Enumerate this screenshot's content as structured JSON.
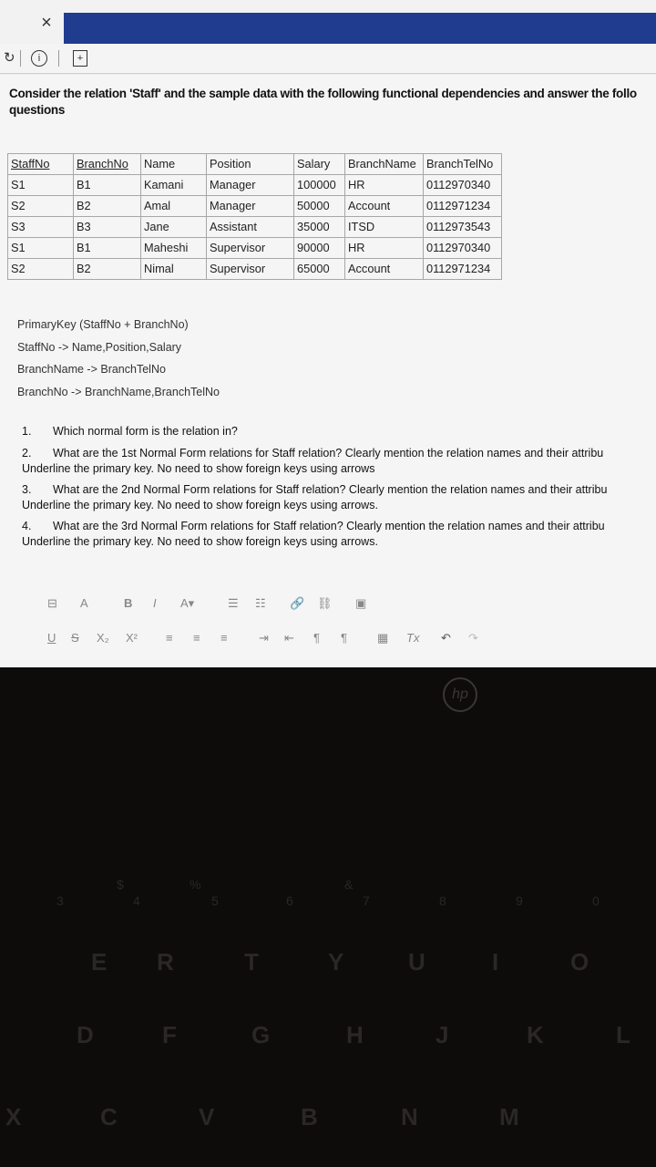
{
  "window": {
    "close_glyph": "×"
  },
  "toolbar_icons": [
    "refresh-icon",
    "info-icon",
    "new-tab-icon"
  ],
  "question": {
    "line1": "Consider the relation 'Staff' and the sample data with the following functional dependencies and answer the follo",
    "line2": "questions"
  },
  "table": {
    "headers": [
      "StaffNo",
      "BranchNo",
      "Name",
      "Position",
      "Salary",
      "BranchName",
      "BranchTelNo"
    ],
    "rows": [
      [
        "S1",
        "B1",
        "Kamani",
        "Manager",
        "100000",
        "HR",
        "0112970340"
      ],
      [
        "S2",
        "B2",
        "Amal",
        "Manager",
        "50000",
        "Account",
        "0112971234"
      ],
      [
        "S3",
        "B3",
        "Jane",
        "Assistant",
        "35000",
        "ITSD",
        "0112973543"
      ],
      [
        "S1",
        "B1",
        "Maheshi",
        "Supervisor",
        "90000",
        "HR",
        "0112970340"
      ],
      [
        "S2",
        "B2",
        "Nimal",
        "Supervisor",
        "65000",
        "Account",
        "0112971234"
      ]
    ]
  },
  "dependencies": [
    "PrimaryKey (StaffNo + BranchNo)",
    "StaffNo -> Name,Position,Salary",
    "BranchName -> BranchTelNo",
    "BranchNo -> BranchName,BranchTelNo"
  ],
  "questions": [
    {
      "num": "1.",
      "line1": "Which normal form is the relation in?",
      "line2": ""
    },
    {
      "num": "2.",
      "line1": "What are the 1st Normal Form relations for Staff relation? Clearly mention the relation names and their attribu",
      "line2": "Underline the primary key. No need to show foreign keys using arrows"
    },
    {
      "num": "3.",
      "line1": "What are the 2nd Normal Form relations for Staff relation? Clearly mention the relation names and their attribu",
      "line2": "Underline the primary key. No need to show foreign keys using arrows."
    },
    {
      "num": "4.",
      "line1": "What are the 3rd Normal Form relations for Staff relation? Clearly mention the relation names and their attribu",
      "line2": "Underline the primary key. No need to show foreign keys using arrows."
    }
  ],
  "editor_toolbar": {
    "row1": [
      "⊟",
      "A",
      "B",
      "I",
      "A▾",
      "☰",
      "☷",
      "🔗",
      "⛓",
      "▣"
    ],
    "row2": [
      "U",
      "S",
      "X₂",
      "X²",
      "≡",
      "≡",
      "≡",
      "⇥",
      "⇤",
      "¶",
      "¶",
      "▦",
      "Tx",
      "↶",
      "↷"
    ]
  },
  "laptop": {
    "brand": "hp",
    "number_row": [
      "3",
      "4",
      "5",
      "6",
      "7",
      "8",
      "9",
      "0"
    ],
    "top_row": [
      "E",
      "R",
      "T",
      "Y",
      "U",
      "I",
      "O"
    ],
    "home_row": [
      "D",
      "F",
      "G",
      "H",
      "J",
      "K",
      "L"
    ],
    "bottom_row": [
      "X",
      "C",
      "V",
      "B",
      "N",
      "M"
    ],
    "symbols": [
      "$",
      "%",
      "&"
    ]
  }
}
